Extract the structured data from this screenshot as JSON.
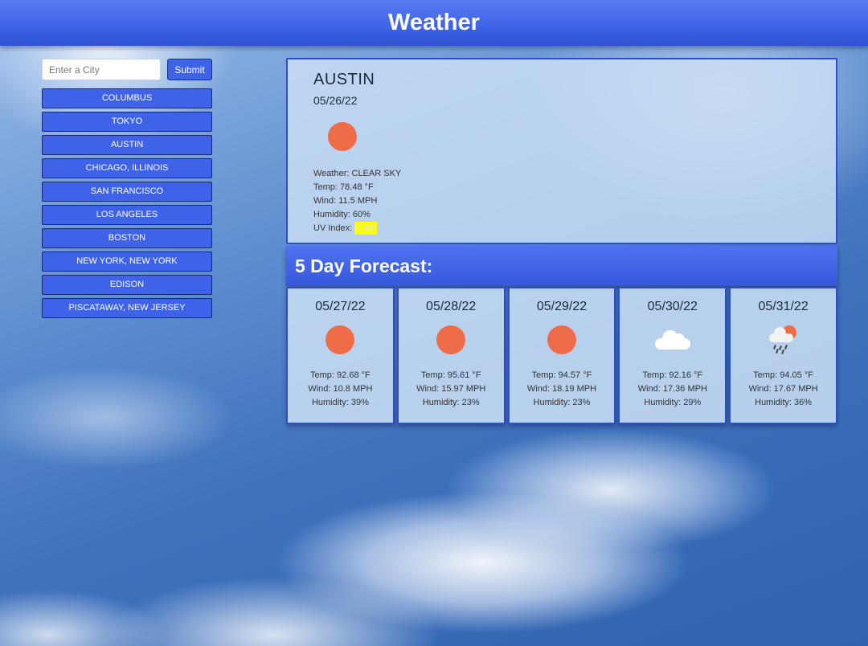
{
  "header": {
    "title": "Weather"
  },
  "search": {
    "placeholder": "Enter a City",
    "value": "",
    "submit_label": "Submit"
  },
  "history": [
    "COLUMBUS",
    "TOKYO",
    "AUSTIN",
    "CHICAGO, ILLINOIS",
    "SAN FRANCISCO",
    "LOS ANGELES",
    "BOSTON",
    "NEW YORK, NEW YORK",
    "EDISON",
    "PISCATAWAY, NEW JERSEY"
  ],
  "current": {
    "city": "AUSTIN",
    "date": "05/26/22",
    "icon": "sun-icon",
    "weather_label": "Weather:",
    "weather_value": "CLEAR SKY",
    "temp_label": "Temp:",
    "temp_value": "78.48 °F",
    "wind_label": "Wind:",
    "wind_value": "11.5 MPH",
    "humidity_label": "Humidity:",
    "humidity_value": "60%",
    "uv_label": "UV Index:",
    "uv_value": "9.69",
    "uv_color": "#ffff00"
  },
  "forecast": {
    "heading": "5 Day Forecast:",
    "days": [
      {
        "date": "05/27/22",
        "icon": "sun-icon",
        "temp": "Temp: 92.68 °F",
        "wind": "Wind: 10.8 MPH",
        "humidity": "Humidity: 39%"
      },
      {
        "date": "05/28/22",
        "icon": "sun-icon",
        "temp": "Temp: 95.61 °F",
        "wind": "Wind: 15.97 MPH",
        "humidity": "Humidity: 23%"
      },
      {
        "date": "05/29/22",
        "icon": "sun-icon",
        "temp": "Temp: 94.57 °F",
        "wind": "Wind: 18.19 MPH",
        "humidity": "Humidity: 23%"
      },
      {
        "date": "05/30/22",
        "icon": "cloud-icon",
        "temp": "Temp: 92.16 °F",
        "wind": "Wind: 17.36 MPH",
        "humidity": "Humidity: 29%"
      },
      {
        "date": "05/31/22",
        "icon": "rain-sun-icon",
        "temp": "Temp: 94.05 °F",
        "wind": "Wind: 17.67 MPH",
        "humidity": "Humidity: 36%"
      }
    ]
  },
  "colors": {
    "accent": "#3f63e8",
    "border": "#2c4fc7",
    "sun": "#ee6d48"
  }
}
